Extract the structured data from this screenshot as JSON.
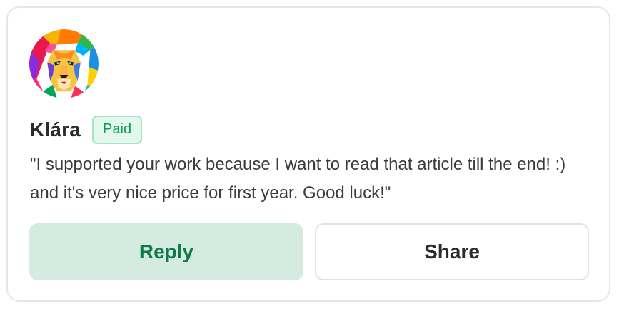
{
  "comment": {
    "author": "Klára",
    "badge": "Paid",
    "message": "\"I supported your work because I want to read that article till the end! :) and it's very nice price for first year. Good luck!\""
  },
  "actions": {
    "reply_label": "Reply",
    "share_label": "Share"
  },
  "colors": {
    "badge_text": "#0d9a52",
    "badge_bg": "#e3f7ec",
    "reply_bg": "#d4ebe1",
    "reply_text": "#107a4a"
  },
  "icons": {
    "avatar": "lion-avatar"
  }
}
